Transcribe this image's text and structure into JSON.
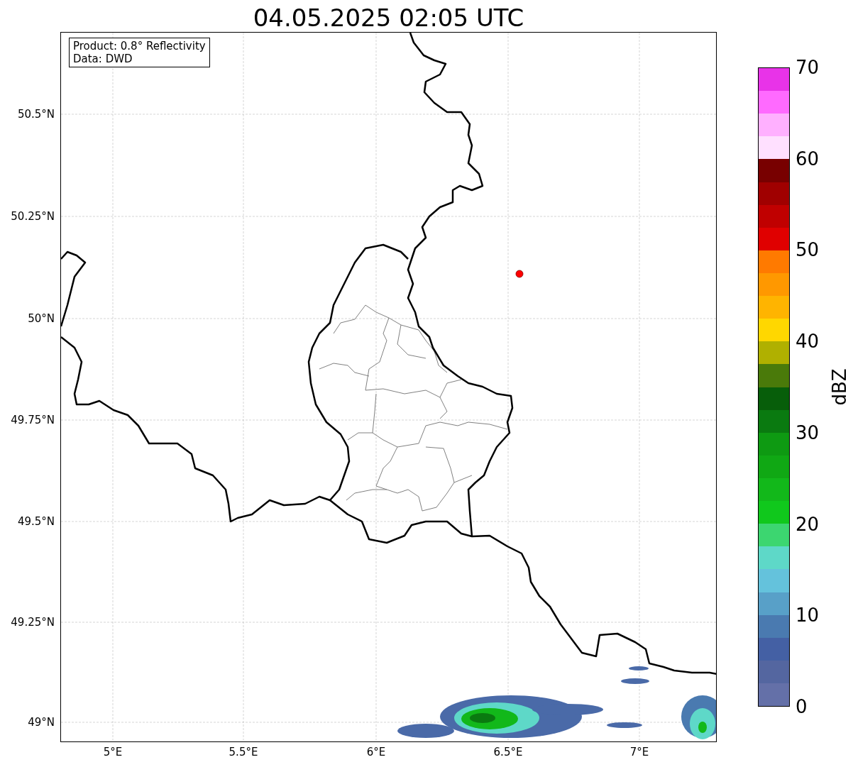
{
  "title": "04.05.2025 02:05 UTC",
  "info_box": [
    "Product: 0.8° Reflectivity",
    "Data: DWD"
  ],
  "lat_ticks": [
    "50.5°N",
    "50.25°N",
    "50°N",
    "49.75°N",
    "49.5°N",
    "49.25°N",
    "49°N"
  ],
  "lon_ticks": [
    "5°E",
    "5.5°E",
    "6°E",
    "6.5°E",
    "7°E"
  ],
  "colorbar": {
    "label": "dBZ",
    "ticks": [
      "70",
      "60",
      "50",
      "40",
      "30",
      "20",
      "10",
      "0"
    ],
    "bands": [
      {
        "color": "#e833e8"
      },
      {
        "color": "#ff6aff"
      },
      {
        "color": "#ffb0ff"
      },
      {
        "color": "#ffe0ff"
      },
      {
        "color": "#780000"
      },
      {
        "color": "#a00000"
      },
      {
        "color": "#c00000"
      },
      {
        "color": "#e00000"
      },
      {
        "color": "#ff7a00"
      },
      {
        "color": "#ff9800"
      },
      {
        "color": "#ffb400"
      },
      {
        "color": "#ffd700"
      },
      {
        "color": "#b0b000"
      },
      {
        "color": "#4a7a0a"
      },
      {
        "color": "#075e0a"
      },
      {
        "color": "#0a7a10"
      },
      {
        "color": "#0e9a12"
      },
      {
        "color": "#10a814"
      },
      {
        "color": "#12b81a"
      },
      {
        "color": "#10c81c"
      },
      {
        "color": "#3cd670"
      },
      {
        "color": "#5ed8c8"
      },
      {
        "color": "#64c2dc"
      },
      {
        "color": "#58a0c8"
      },
      {
        "color": "#4a7ab0"
      },
      {
        "color": "#4460a4"
      },
      {
        "color": "#5466a0"
      },
      {
        "color": "#6470a8"
      }
    ]
  }
}
